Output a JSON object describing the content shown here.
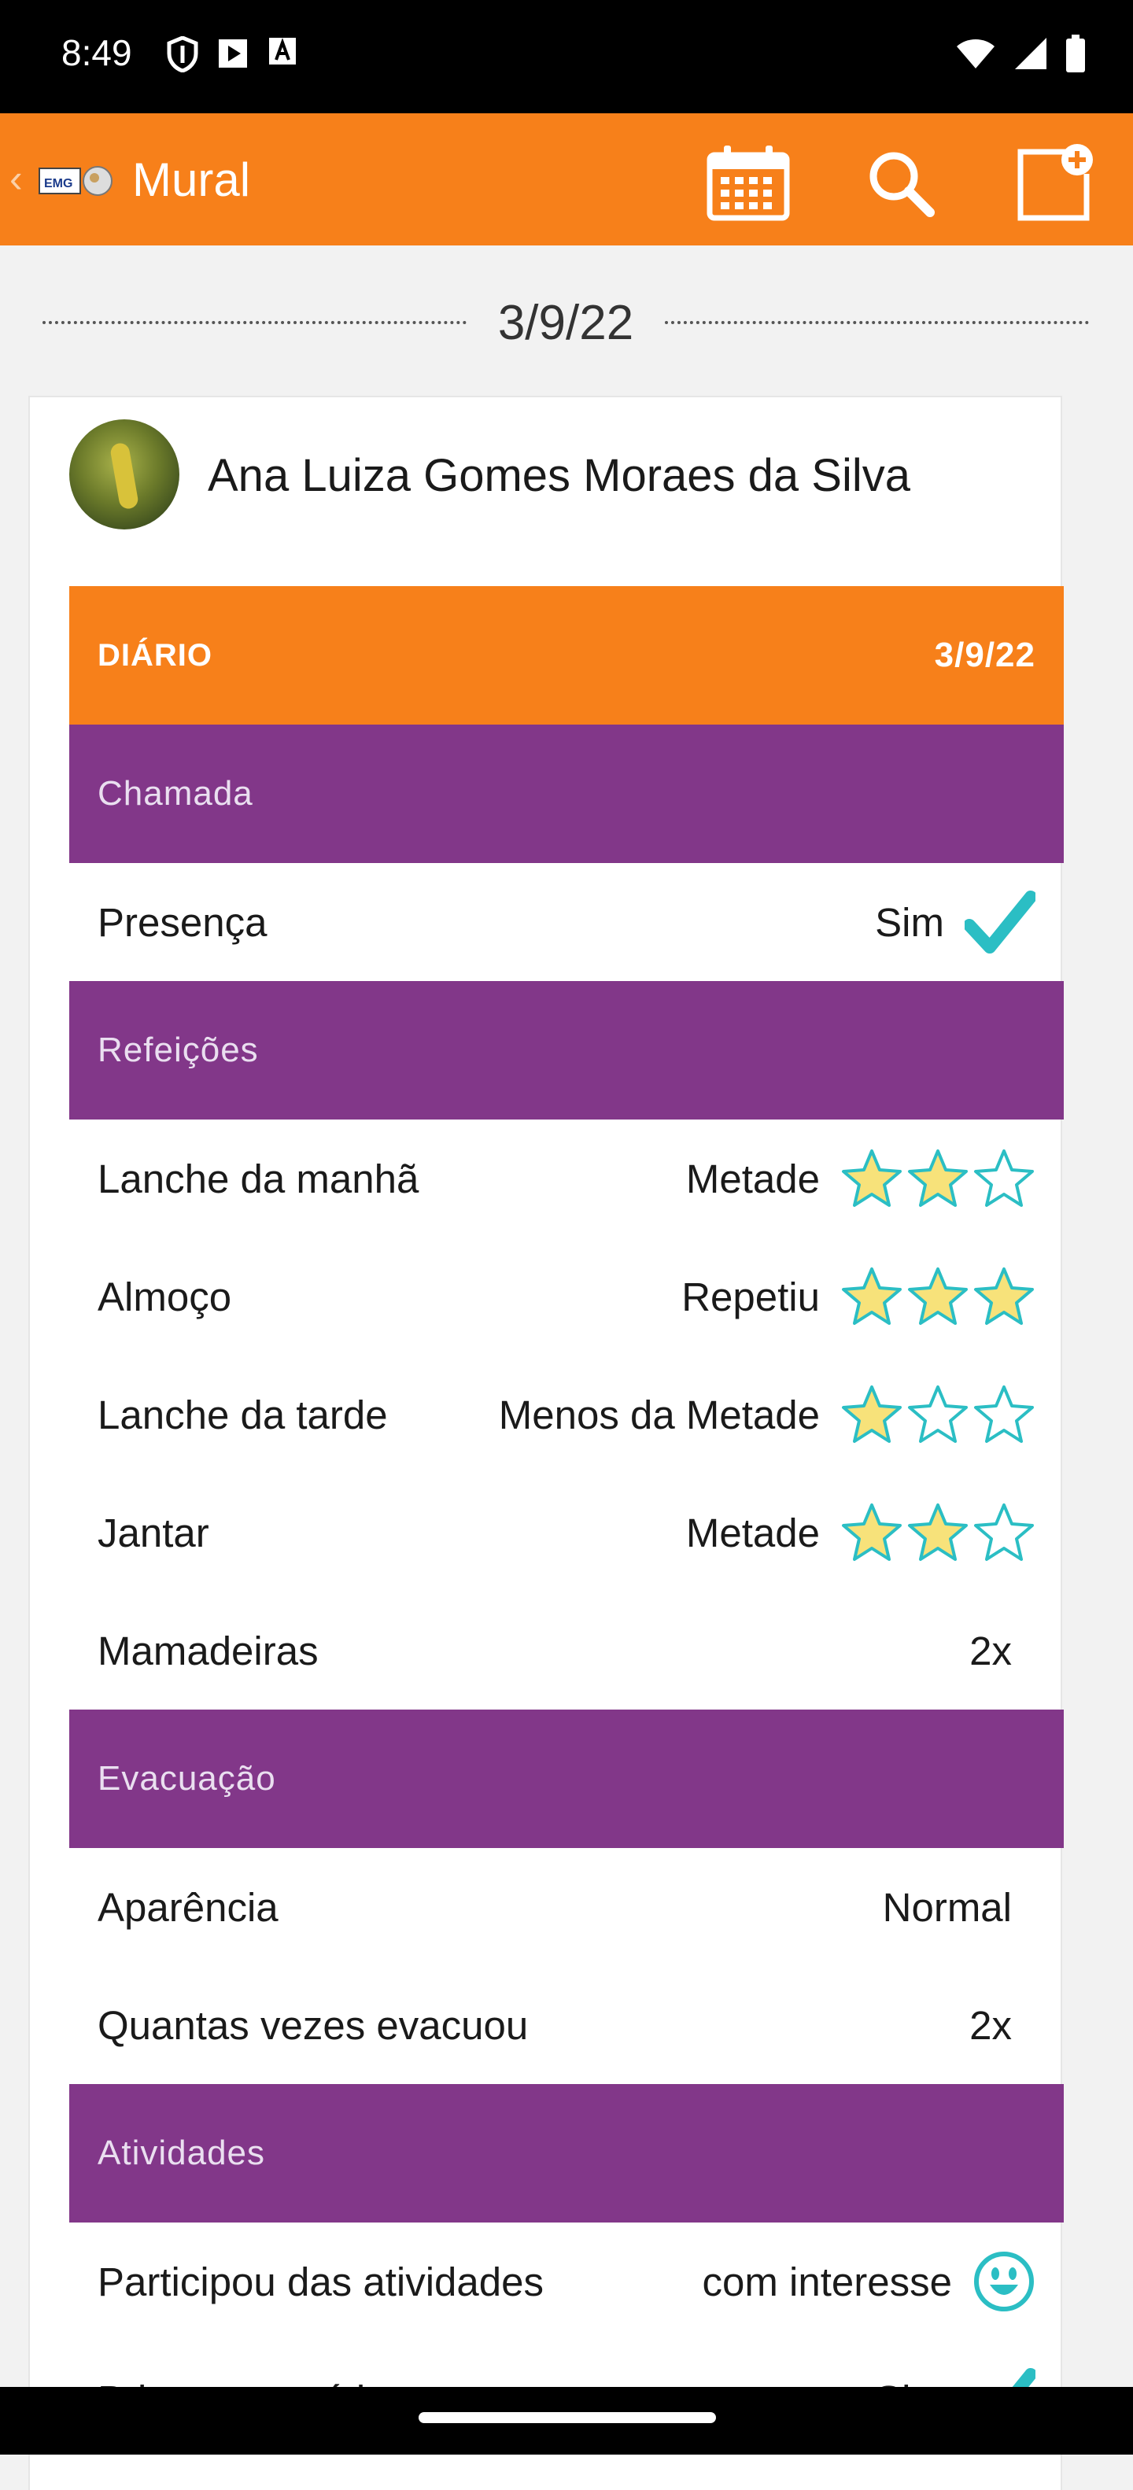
{
  "status_bar": {
    "time": "8:49"
  },
  "app_bar": {
    "title": "Mural",
    "icons": [
      "back-chevron-icon",
      "calendar-icon",
      "search-icon",
      "new-post-icon"
    ]
  },
  "feed": {
    "date": "3/9/22"
  },
  "post": {
    "author": "Ana Luiza Gomes Moraes da Silva",
    "diary_label": "DIÁRIO",
    "diary_date": "3/9/22",
    "sections": {
      "chamada": {
        "title": "Chamada",
        "rows": [
          {
            "label": "Presença",
            "value": "Sim"
          }
        ]
      },
      "refeicoes": {
        "title": "Refeições",
        "rows": [
          {
            "label": "Lanche da manhã",
            "value": "Metade",
            "stars": 2
          },
          {
            "label": "Almoço",
            "value": "Repetiu",
            "stars": 3
          },
          {
            "label": "Lanche da tarde",
            "value": "Menos da Metade",
            "stars": 1
          },
          {
            "label": "Jantar",
            "value": "Metade",
            "stars": 2
          },
          {
            "label": "Mamadeiras",
            "value": "2x"
          }
        ]
      },
      "evacuacao": {
        "title": "Evacuação",
        "rows": [
          {
            "label": "Aparência",
            "value": "Normal"
          },
          {
            "label": "Quantas vezes evacuou",
            "value": "2x"
          }
        ]
      },
      "atividades": {
        "title": "Atividades",
        "rows": [
          {
            "label": "Participou das atividades",
            "value": "com interesse"
          },
          {
            "label": "Brincou no pátio",
            "value": "Sim"
          }
        ]
      }
    }
  },
  "colors": {
    "orange": "#f7801a",
    "purple": "#823789",
    "teal": "#2bbec4",
    "star_fill": "#f7e27a"
  }
}
